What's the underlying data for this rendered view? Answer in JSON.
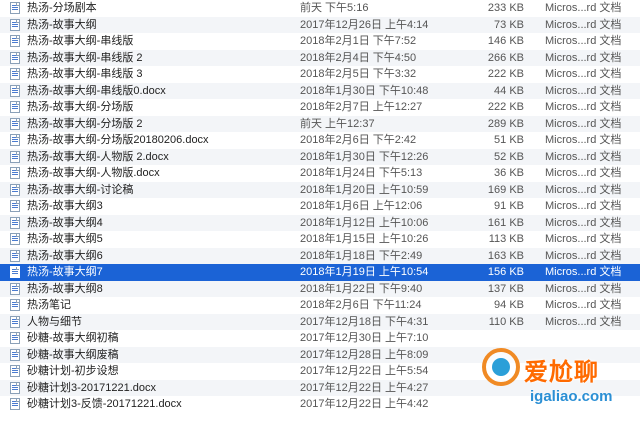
{
  "files": [
    {
      "name": "热汤-分场剧本",
      "date": "前天 下午5:16",
      "size": "233 KB",
      "kind": "Micros...rd 文档"
    },
    {
      "name": "热汤-故事大纲",
      "date": "2017年12月26日 上午4:14",
      "size": "73 KB",
      "kind": "Micros...rd 文档"
    },
    {
      "name": "热汤-故事大纲-串线版",
      "date": "2018年2月1日 下午7:52",
      "size": "146 KB",
      "kind": "Micros...rd 文档"
    },
    {
      "name": "热汤-故事大纲-串线版 2",
      "date": "2018年2月4日 下午4:50",
      "size": "266 KB",
      "kind": "Micros...rd 文档"
    },
    {
      "name": "热汤-故事大纲-串线版 3",
      "date": "2018年2月5日 下午3:32",
      "size": "222 KB",
      "kind": "Micros...rd 文档"
    },
    {
      "name": "热汤-故事大纲-串线版0.docx",
      "date": "2018年1月30日 下午10:48",
      "size": "44 KB",
      "kind": "Micros...rd 文档"
    },
    {
      "name": "热汤-故事大纲-分场版",
      "date": "2018年2月7日 上午12:27",
      "size": "222 KB",
      "kind": "Micros...rd 文档"
    },
    {
      "name": "热汤-故事大纲-分场版 2",
      "date": "前天 上午12:37",
      "size": "289 KB",
      "kind": "Micros...rd 文档"
    },
    {
      "name": "热汤-故事大纲-分场版20180206.docx",
      "date": "2018年2月6日 下午2:42",
      "size": "51 KB",
      "kind": "Micros...rd 文档"
    },
    {
      "name": "热汤-故事大纲-人物版 2.docx",
      "date": "2018年1月30日 下午12:26",
      "size": "52 KB",
      "kind": "Micros...rd 文档"
    },
    {
      "name": "热汤-故事大纲-人物版.docx",
      "date": "2018年1月24日 下午5:13",
      "size": "36 KB",
      "kind": "Micros...rd 文档"
    },
    {
      "name": "热汤-故事大纲-讨论稿",
      "date": "2018年1月20日 上午10:59",
      "size": "169 KB",
      "kind": "Micros...rd 文档"
    },
    {
      "name": "热汤-故事大纲3",
      "date": "2018年1月6日 上午12:06",
      "size": "91 KB",
      "kind": "Micros...rd 文档"
    },
    {
      "name": "热汤-故事大纲4",
      "date": "2018年1月12日 上午10:06",
      "size": "161 KB",
      "kind": "Micros...rd 文档"
    },
    {
      "name": "热汤-故事大纲5",
      "date": "2018年1月15日 上午10:26",
      "size": "113 KB",
      "kind": "Micros...rd 文档"
    },
    {
      "name": "热汤-故事大纲6",
      "date": "2018年1月18日 下午2:49",
      "size": "163 KB",
      "kind": "Micros...rd 文档"
    },
    {
      "name": "热汤-故事大纲7",
      "date": "2018年1月19日 上午10:54",
      "size": "156 KB",
      "kind": "Micros...rd 文档"
    },
    {
      "name": "热汤-故事大纲8",
      "date": "2018年1月22日 下午9:40",
      "size": "137 KB",
      "kind": "Micros...rd 文档"
    },
    {
      "name": "热汤笔记",
      "date": "2018年2月6日 下午11:24",
      "size": "94 KB",
      "kind": "Micros...rd 文档"
    },
    {
      "name": "人物与细节",
      "date": "2017年12月18日 下午4:31",
      "size": "110 KB",
      "kind": "Micros...rd 文档"
    },
    {
      "name": "砂糖-故事大纲初稿",
      "date": "2017年12月30日 上午7:10",
      "size": "",
      "kind": ""
    },
    {
      "name": "砂糖-故事大纲废稿",
      "date": "2017年12月28日 上午8:09",
      "size": "",
      "kind": ""
    },
    {
      "name": "砂糖计划-初步设想",
      "date": "2017年12月22日 上午5:54",
      "size": "",
      "kind": ""
    },
    {
      "name": "砂糖计划3-20171221.docx",
      "date": "2017年12月22日 上午4:27",
      "size": "",
      "kind": ""
    },
    {
      "name": "砂糖计划3-反馈-20171221.docx",
      "date": "2017年12月22日 上午4:42",
      "size": "",
      "kind": ""
    }
  ],
  "selected_index": 16,
  "watermark": {
    "title": "爱尬聊",
    "url": "igaliao.com"
  },
  "colors": {
    "selection": "#1b63d6",
    "alt_row": "#f3f5f8",
    "watermark_orange": "#ff6a00",
    "watermark_blue": "#2b8fd4"
  }
}
